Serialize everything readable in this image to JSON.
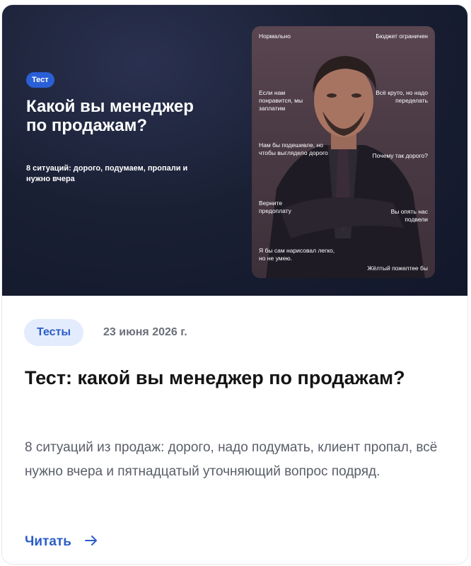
{
  "hero": {
    "badge": "Тест",
    "title": "Какой вы менеджер по продажам?",
    "subtitle": "8 ситуаций: дорого, подумаем, пропали и нужно вчера"
  },
  "meme": {
    "left": [
      "Нормально",
      "Если нам понравится, мы заплатим",
      "Нам бы подешевле, но чтобы выглядело дорого",
      "Верните предоплату",
      "Я бы сам нарисовал легко, но не умею."
    ],
    "right": [
      "Бюджет ограничен",
      "Всё круто, но надо переделать",
      "Почему так дорого?",
      "Вы опять нас подвели",
      "Жёлтый пожелтее бы"
    ]
  },
  "card": {
    "tag": "Тесты",
    "date": "23 июня 2026 г.",
    "title": "Тест: какой вы менеджер по продажам?",
    "description": "8 ситуаций из продаж: дорого, надо подумать, клиент пропал, всё нужно вчера и пятнадцатый уточняющий вопрос подряд.",
    "read_label": "Читать",
    "read_icon": "arrow-right-icon"
  },
  "colors": {
    "hero_bg": "#1a2034",
    "badge": "#2a5fd6",
    "accent": "#2b5dc9",
    "tag_bg": "#e3ecfc"
  }
}
